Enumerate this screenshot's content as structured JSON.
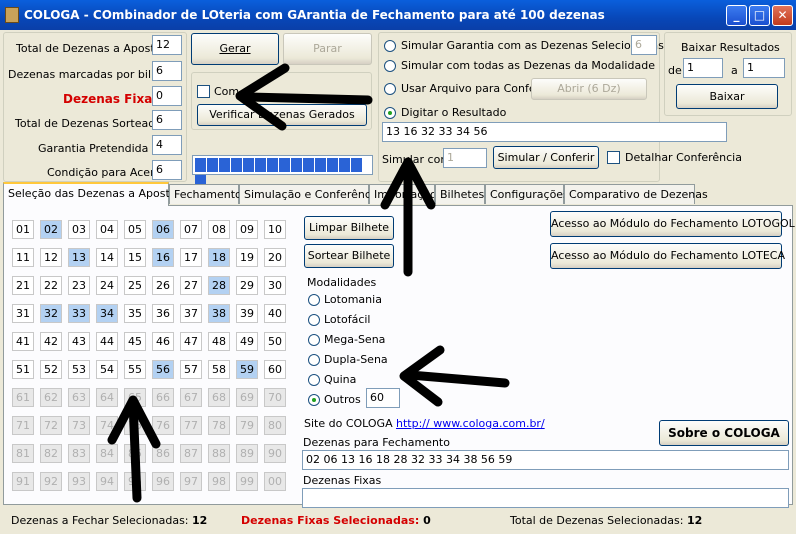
{
  "window": {
    "title": "COLOGA - COmbinador de LOteria com GArantia de Fechamento para até 100 dezenas",
    "min": "_",
    "max": "□",
    "close": "✕"
  },
  "form": {
    "total_apostar_label": "Total de Dezenas a Apostar",
    "total_apostar": "12",
    "por_bilhete_label": "Dezenas marcadas por bilhete",
    "por_bilhete": "6",
    "fixas_label": "Dezenas Fixas",
    "fixas": "0",
    "sorteadas_label": "Total de Dezenas Sorteadas",
    "sorteadas": "6",
    "garantia_label": "Garantia Pretendida >=",
    "garantia": "4",
    "condicao_label": "Condição para Acerto",
    "condicao": "6"
  },
  "actions": {
    "gerar": "Gerar",
    "parar": "Parar",
    "checkbox_label": "Com",
    "verificar": "Verificar Dezenas Gerados"
  },
  "progress": {
    "segments": 15
  },
  "sim": {
    "opt1": "Simular Garantia com as Dezenas Selecionadas",
    "opt1_value": "6",
    "opt2": "Simular com todas as Dezenas da Modalidade",
    "opt3": "Usar Arquivo para Conferir",
    "abrir": "Abrir (6 Dz)",
    "opt4": "Digitar o Resultado",
    "resultado": "13 16 32 33 34 56",
    "simular_com_label": "Simular com",
    "simular_com": "1",
    "simular_btn": "Simular / Conferir",
    "detalhar": "Detalhar Conferência"
  },
  "baixar": {
    "title": "Baixar Resultados",
    "de_label": "de",
    "de": "1",
    "a_label": "a",
    "a": "1",
    "btn": "Baixar"
  },
  "tabs": [
    "Seleção das Dezenas a Apostar",
    "Fechamento",
    "Simulação e Conferência",
    "Importação",
    "Bilhetes",
    "Configurações",
    "Comparativo de Dezenas"
  ],
  "grid": {
    "numbers": [
      "01",
      "02",
      "03",
      "04",
      "05",
      "06",
      "07",
      "08",
      "09",
      "10",
      "11",
      "12",
      "13",
      "14",
      "15",
      "16",
      "17",
      "18",
      "19",
      "20",
      "21",
      "22",
      "23",
      "24",
      "25",
      "26",
      "27",
      "28",
      "29",
      "30",
      "31",
      "32",
      "33",
      "34",
      "35",
      "36",
      "37",
      "38",
      "39",
      "40",
      "41",
      "42",
      "43",
      "44",
      "45",
      "46",
      "47",
      "48",
      "49",
      "50",
      "51",
      "52",
      "53",
      "54",
      "55",
      "56",
      "57",
      "58",
      "59",
      "60",
      "61",
      "62",
      "63",
      "64",
      "65",
      "66",
      "67",
      "68",
      "69",
      "70",
      "71",
      "72",
      "73",
      "74",
      "75",
      "76",
      "77",
      "78",
      "79",
      "80",
      "81",
      "82",
      "83",
      "84",
      "85",
      "86",
      "87",
      "88",
      "89",
      "90",
      "91",
      "92",
      "93",
      "94",
      "95",
      "96",
      "97",
      "98",
      "99",
      "00"
    ],
    "selected": [
      "02",
      "06",
      "13",
      "16",
      "18",
      "28",
      "32",
      "33",
      "34",
      "38",
      "56",
      "59"
    ],
    "enabled_count": 60
  },
  "buttons": {
    "limpar": "Limpar Bilhete",
    "sortear": "Sortear Bilhete",
    "lotogol": "Acesso ao Módulo do Fechamento LOTOGOL",
    "loteca": "Acesso ao Módulo do Fechamento LOTECA",
    "sobre": "Sobre o COLOGA"
  },
  "modalidades": {
    "title": "Modalidades",
    "items": [
      "Lotomania",
      "Lotofácil",
      "Mega-Sena",
      "Dupla-Sena",
      "Quina",
      "Outros"
    ],
    "selected": "Outros",
    "outros_value": "60"
  },
  "site": {
    "label": "Site do COLOGA",
    "link": "http:// www.cologa.com.br/"
  },
  "fechamento": {
    "label": "Dezenas para Fechamento",
    "value": "02 06 13 16 18 28 32 33 34 38 56 59"
  },
  "fixas_box": {
    "label": "Dezenas Fixas",
    "value": ""
  },
  "status": {
    "fechar_label": "Dezenas a Fechar Selecionadas:",
    "fechar": "12",
    "fixas_label": "Dezenas Fixas Selecionadas:",
    "fixas": "0",
    "total_label": "Total de Dezenas Selecionadas:",
    "total": "12"
  },
  "colors": {
    "title_bar": "#0847b8",
    "selected_cell": "#b3d1f2",
    "red": "#d40000",
    "progress": "#2a63d6"
  }
}
